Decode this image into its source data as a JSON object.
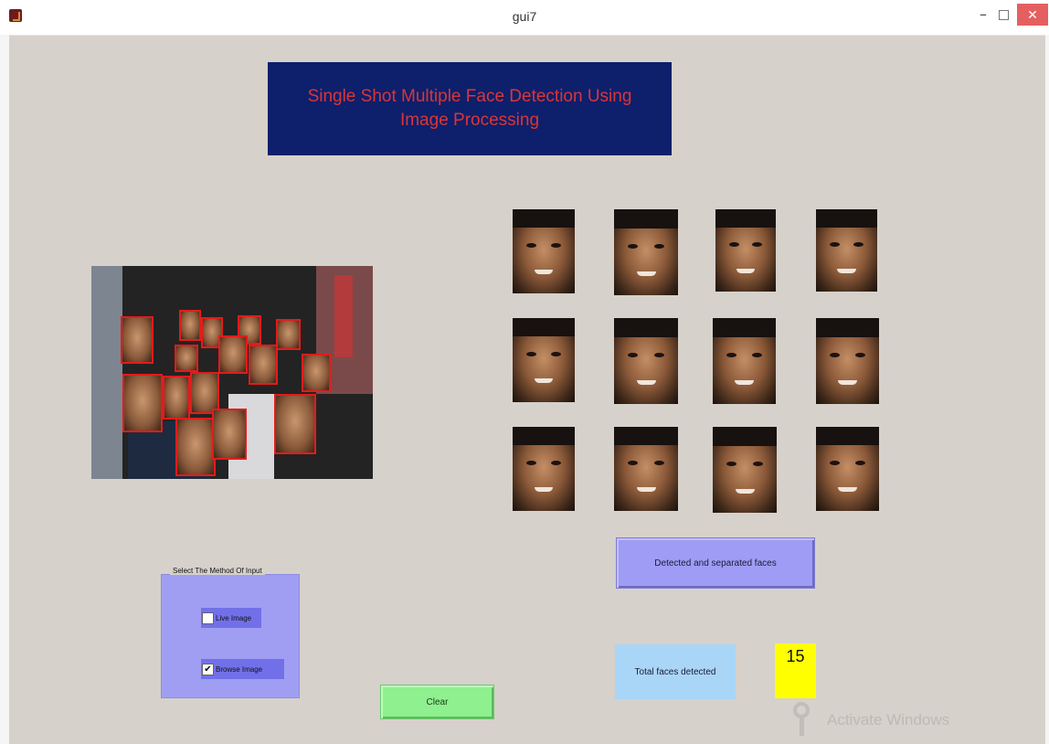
{
  "window": {
    "title": "gui7",
    "minimize_label": "–",
    "close_label": "✕"
  },
  "header": {
    "title": "Single Shot Multiple Face Detection Using Image Processing"
  },
  "buttons": {
    "separated_faces": "Detected and separated faces",
    "clear": "Clear"
  },
  "result": {
    "total_label": "Total faces detected",
    "total_count": "15"
  },
  "input_method": {
    "legend": "Select The Method Of Input",
    "options": [
      {
        "label": "Live Image",
        "checked": false
      },
      {
        "label": "Browse Image",
        "checked": true
      }
    ],
    "check_mark": "✔"
  },
  "watermark": {
    "text": "Activate Windows"
  },
  "icons": {
    "app": "matlab-icon",
    "minimize": "minimize-icon",
    "maximize": "maximize-icon",
    "close": "close-icon",
    "watermark": "key-icon"
  },
  "colors": {
    "background": "#d6d1cb",
    "header_bg": "#0e1f6b",
    "header_text": "#d8363a",
    "detection_box": "#e41b1b",
    "purple_button": "#9e9cf4",
    "count_bg": "#ffff00",
    "total_label_bg": "#a9d6f7",
    "clear_bg": "#8ef08e"
  }
}
